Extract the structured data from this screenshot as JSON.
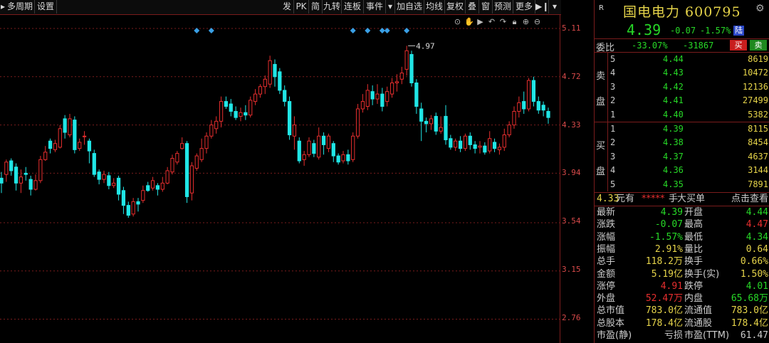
{
  "toolbar": {
    "left": [
      "多周期",
      "设置"
    ],
    "right": [
      "发",
      "PK",
      "简",
      "九转",
      "连板",
      "事件",
      "加自选",
      "均线",
      "复权",
      "叠",
      "窗",
      "预测",
      "更多"
    ]
  },
  "price_axis": [
    "5.11",
    "4.72",
    "4.33",
    "3.94",
    "3.54",
    "3.15",
    "2.76"
  ],
  "colors": {
    "up": "#e62e2e",
    "down": "#20e6e6",
    "green": "#27d827",
    "yellow": "#e6d44a",
    "grid": "#7a1c1c"
  },
  "chart_data": {
    "type": "candlestick",
    "high_label": "4.97",
    "ylim": [
      2.62,
      5.18
    ],
    "candles": [
      {
        "o": 3.9,
        "c": 3.86,
        "h": 3.95,
        "l": 3.78
      },
      {
        "o": 3.93,
        "c": 4.03,
        "h": 4.05,
        "l": 3.87
      },
      {
        "o": 4.04,
        "c": 3.96,
        "h": 4.06,
        "l": 3.92
      },
      {
        "o": 3.99,
        "c": 3.86,
        "h": 4.02,
        "l": 3.8
      },
      {
        "o": 3.86,
        "c": 3.91,
        "h": 3.97,
        "l": 3.78
      },
      {
        "o": 3.94,
        "c": 3.93,
        "h": 3.99,
        "l": 3.88
      },
      {
        "o": 3.89,
        "c": 3.81,
        "h": 3.92,
        "l": 3.76
      },
      {
        "o": 3.81,
        "c": 3.88,
        "h": 3.93,
        "l": 3.8
      },
      {
        "o": 3.88,
        "c": 4.05,
        "h": 4.08,
        "l": 3.86
      },
      {
        "o": 4.05,
        "c": 4.11,
        "h": 4.16,
        "l": 4.04
      },
      {
        "o": 4.2,
        "c": 4.14,
        "h": 4.22,
        "l": 4.1
      },
      {
        "o": 4.13,
        "c": 4.18,
        "h": 4.21,
        "l": 4.11
      },
      {
        "o": 4.15,
        "c": 4.3,
        "h": 4.33,
        "l": 4.14
      },
      {
        "o": 4.38,
        "c": 4.27,
        "h": 4.41,
        "l": 4.22
      },
      {
        "o": 4.25,
        "c": 4.38,
        "h": 4.42,
        "l": 4.23
      },
      {
        "o": 4.37,
        "c": 4.13,
        "h": 4.4,
        "l": 4.1
      },
      {
        "o": 4.14,
        "c": 4.19,
        "h": 4.22,
        "l": 4.12
      },
      {
        "o": 4.24,
        "c": 4.24,
        "h": 4.28,
        "l": 4.17
      },
      {
        "o": 4.2,
        "c": 4.12,
        "h": 4.22,
        "l": 4.02
      },
      {
        "o": 4.1,
        "c": 3.93,
        "h": 4.13,
        "l": 3.91
      },
      {
        "o": 3.95,
        "c": 3.89,
        "h": 3.97,
        "l": 3.85
      },
      {
        "o": 3.89,
        "c": 3.93,
        "h": 3.96,
        "l": 3.86
      },
      {
        "o": 3.92,
        "c": 3.84,
        "h": 3.95,
        "l": 3.81
      },
      {
        "o": 3.84,
        "c": 3.86,
        "h": 3.9,
        "l": 3.82
      },
      {
        "o": 3.9,
        "c": 3.77,
        "h": 3.92,
        "l": 3.72
      },
      {
        "o": 3.8,
        "c": 3.68,
        "h": 3.83,
        "l": 3.61
      },
      {
        "o": 3.68,
        "c": 3.6,
        "h": 3.71,
        "l": 3.58
      },
      {
        "o": 3.61,
        "c": 3.71,
        "h": 3.74,
        "l": 3.59
      },
      {
        "o": 3.71,
        "c": 3.69,
        "h": 3.74,
        "l": 3.63
      },
      {
        "o": 3.72,
        "c": 3.8,
        "h": 3.84,
        "l": 3.7
      },
      {
        "o": 3.84,
        "c": 3.8,
        "h": 3.87,
        "l": 3.79
      },
      {
        "o": 3.82,
        "c": 3.88,
        "h": 3.91,
        "l": 3.8
      },
      {
        "o": 3.84,
        "c": 3.81,
        "h": 3.86,
        "l": 3.76
      },
      {
        "o": 3.81,
        "c": 3.86,
        "h": 3.91,
        "l": 3.79
      },
      {
        "o": 3.86,
        "c": 3.96,
        "h": 3.99,
        "l": 3.85
      },
      {
        "o": 3.95,
        "c": 4.06,
        "h": 4.09,
        "l": 3.93
      },
      {
        "o": 4.03,
        "c": 4.1,
        "h": 4.12,
        "l": 4.01
      },
      {
        "o": 4.14,
        "c": 4.18,
        "h": 4.23,
        "l": 4.13
      },
      {
        "o": 4.18,
        "c": 3.75,
        "h": 4.2,
        "l": 3.7
      },
      {
        "o": 3.78,
        "c": 4.0,
        "h": 4.03,
        "l": 3.72
      },
      {
        "o": 3.98,
        "c": 4.08,
        "h": 4.1,
        "l": 3.96
      },
      {
        "o": 4.05,
        "c": 4.14,
        "h": 4.22,
        "l": 4.03
      },
      {
        "o": 4.14,
        "c": 4.24,
        "h": 4.27,
        "l": 4.1
      },
      {
        "o": 4.24,
        "c": 4.33,
        "h": 4.37,
        "l": 4.22
      },
      {
        "o": 4.3,
        "c": 4.36,
        "h": 4.4,
        "l": 4.26
      },
      {
        "o": 4.36,
        "c": 4.52,
        "h": 4.56,
        "l": 4.31
      },
      {
        "o": 4.52,
        "c": 4.48,
        "h": 4.56,
        "l": 4.46
      },
      {
        "o": 4.5,
        "c": 4.44,
        "h": 4.54,
        "l": 4.4
      },
      {
        "o": 4.44,
        "c": 4.39,
        "h": 4.48,
        "l": 4.37
      },
      {
        "o": 4.4,
        "c": 4.43,
        "h": 4.47,
        "l": 4.36
      },
      {
        "o": 4.43,
        "c": 4.41,
        "h": 4.49,
        "l": 4.37
      },
      {
        "o": 4.41,
        "c": 4.53,
        "h": 4.56,
        "l": 4.39
      },
      {
        "o": 4.52,
        "c": 4.58,
        "h": 4.62,
        "l": 4.49
      },
      {
        "o": 4.58,
        "c": 4.64,
        "h": 4.66,
        "l": 4.55
      },
      {
        "o": 4.64,
        "c": 4.7,
        "h": 4.73,
        "l": 4.58
      },
      {
        "o": 4.66,
        "c": 4.85,
        "h": 4.89,
        "l": 4.63
      },
      {
        "o": 4.82,
        "c": 4.72,
        "h": 4.86,
        "l": 4.64
      },
      {
        "o": 4.76,
        "c": 4.61,
        "h": 4.79,
        "l": 4.58
      },
      {
        "o": 4.61,
        "c": 4.52,
        "h": 4.65,
        "l": 4.48
      },
      {
        "o": 4.52,
        "c": 4.25,
        "h": 4.56,
        "l": 4.21
      },
      {
        "o": 4.24,
        "c": 4.33,
        "h": 4.4,
        "l": 4.13
      },
      {
        "o": 4.2,
        "c": 4.04,
        "h": 4.23,
        "l": 4.02
      },
      {
        "o": 4.05,
        "c": 4.09,
        "h": 4.12,
        "l": 4.0
      },
      {
        "o": 4.09,
        "c": 4.2,
        "h": 4.23,
        "l": 4.07
      },
      {
        "o": 4.18,
        "c": 4.1,
        "h": 4.21,
        "l": 4.07
      },
      {
        "o": 4.07,
        "c": 4.24,
        "h": 4.31,
        "l": 4.05
      },
      {
        "o": 4.24,
        "c": 4.17,
        "h": 4.27,
        "l": 4.09
      },
      {
        "o": 4.14,
        "c": 4.24,
        "h": 4.26,
        "l": 4.11
      },
      {
        "o": 4.18,
        "c": 4.08,
        "h": 4.2,
        "l": 4.03
      },
      {
        "o": 4.08,
        "c": 4.03,
        "h": 4.1,
        "l": 4.01
      },
      {
        "o": 4.04,
        "c": 4.09,
        "h": 4.12,
        "l": 4.02
      },
      {
        "o": 4.09,
        "c": 4.04,
        "h": 4.13,
        "l": 4.01
      },
      {
        "o": 4.05,
        "c": 4.24,
        "h": 4.27,
        "l": 4.03
      },
      {
        "o": 4.24,
        "c": 4.46,
        "h": 4.5,
        "l": 4.22
      },
      {
        "o": 4.46,
        "c": 4.52,
        "h": 4.58,
        "l": 4.43
      },
      {
        "o": 4.48,
        "c": 4.61,
        "h": 4.66,
        "l": 4.45
      },
      {
        "o": 4.6,
        "c": 4.54,
        "h": 4.65,
        "l": 4.49
      },
      {
        "o": 4.54,
        "c": 4.58,
        "h": 4.66,
        "l": 4.5
      },
      {
        "o": 4.58,
        "c": 4.48,
        "h": 4.63,
        "l": 4.44
      },
      {
        "o": 4.52,
        "c": 4.6,
        "h": 4.64,
        "l": 4.48
      },
      {
        "o": 4.58,
        "c": 4.67,
        "h": 4.71,
        "l": 4.55
      },
      {
        "o": 4.67,
        "c": 4.68,
        "h": 4.74,
        "l": 4.6
      },
      {
        "o": 4.7,
        "c": 4.75,
        "h": 4.8,
        "l": 4.66
      },
      {
        "o": 4.78,
        "c": 4.93,
        "h": 4.97,
        "l": 4.73
      },
      {
        "o": 4.9,
        "c": 4.67,
        "h": 4.93,
        "l": 4.64
      },
      {
        "o": 4.67,
        "c": 4.48,
        "h": 4.7,
        "l": 4.42
      },
      {
        "o": 4.46,
        "c": 4.36,
        "h": 4.51,
        "l": 4.2
      },
      {
        "o": 4.36,
        "c": 4.34,
        "h": 4.39,
        "l": 4.27
      },
      {
        "o": 4.34,
        "c": 4.38,
        "h": 4.41,
        "l": 4.29
      },
      {
        "o": 4.4,
        "c": 4.28,
        "h": 4.43,
        "l": 4.25
      },
      {
        "o": 4.28,
        "c": 4.31,
        "h": 4.4,
        "l": 4.26
      },
      {
        "o": 4.4,
        "c": 4.21,
        "h": 4.49,
        "l": 4.17
      },
      {
        "o": 4.22,
        "c": 4.15,
        "h": 4.25,
        "l": 4.13
      },
      {
        "o": 4.15,
        "c": 4.2,
        "h": 4.22,
        "l": 4.12
      },
      {
        "o": 4.2,
        "c": 4.14,
        "h": 4.24,
        "l": 4.11
      },
      {
        "o": 4.14,
        "c": 4.24,
        "h": 4.26,
        "l": 4.12
      },
      {
        "o": 4.24,
        "c": 4.17,
        "h": 4.27,
        "l": 4.13
      },
      {
        "o": 4.17,
        "c": 4.14,
        "h": 4.2,
        "l": 4.1
      },
      {
        "o": 4.15,
        "c": 4.16,
        "h": 4.2,
        "l": 4.1
      },
      {
        "o": 4.16,
        "c": 4.11,
        "h": 4.19,
        "l": 4.09
      },
      {
        "o": 4.12,
        "c": 4.22,
        "h": 4.28,
        "l": 4.1
      },
      {
        "o": 4.19,
        "c": 4.14,
        "h": 4.22,
        "l": 4.11
      },
      {
        "o": 4.13,
        "c": 4.15,
        "h": 4.18,
        "l": 4.09
      },
      {
        "o": 4.15,
        "c": 4.25,
        "h": 4.3,
        "l": 4.12
      },
      {
        "o": 4.25,
        "c": 4.33,
        "h": 4.36,
        "l": 4.23
      },
      {
        "o": 4.33,
        "c": 4.44,
        "h": 4.48,
        "l": 4.3
      },
      {
        "o": 4.44,
        "c": 4.51,
        "h": 4.56,
        "l": 4.39
      },
      {
        "o": 4.52,
        "c": 4.46,
        "h": 4.6,
        "l": 4.42
      },
      {
        "o": 4.46,
        "c": 4.69,
        "h": 4.71,
        "l": 4.44
      },
      {
        "o": 4.69,
        "c": 4.52,
        "h": 4.72,
        "l": 4.48
      },
      {
        "o": 4.52,
        "c": 4.45,
        "h": 4.56,
        "l": 4.42
      },
      {
        "o": 4.49,
        "c": 4.45,
        "h": 4.52,
        "l": 4.4
      },
      {
        "o": 4.44,
        "c": 4.39,
        "h": 4.47,
        "l": 4.34
      }
    ],
    "event_marker_indices": [
      40,
      43,
      72,
      75,
      78,
      79,
      83
    ]
  },
  "quote": {
    "badge": "R",
    "title": "国电电力 600795",
    "price": "4.39",
    "change": "-0.07",
    "pct": "-1.57%",
    "board": "陆"
  },
  "webi": {
    "label": "委比",
    "ratio": "-33.07%",
    "diff": "-31867",
    "buy": "买",
    "sell": "卖"
  },
  "asks": {
    "side": [
      "卖",
      "盘"
    ],
    "rows": [
      {
        "lv": "5",
        "pr": "4.44",
        "qt": "8619"
      },
      {
        "lv": "4",
        "pr": "4.43",
        "qt": "10472"
      },
      {
        "lv": "3",
        "pr": "4.42",
        "qt": "12136"
      },
      {
        "lv": "2",
        "pr": "4.41",
        "qt": "27499"
      },
      {
        "lv": "1",
        "pr": "4.40",
        "qt": "5382"
      }
    ]
  },
  "bids": {
    "side": [
      "买",
      "盘"
    ],
    "rows": [
      {
        "lv": "1",
        "pr": "4.39",
        "qt": "8115"
      },
      {
        "lv": "2",
        "pr": "4.38",
        "qt": "8454"
      },
      {
        "lv": "3",
        "pr": "4.37",
        "qt": "4637"
      },
      {
        "lv": "4",
        "pr": "4.36",
        "qt": "3144"
      },
      {
        "lv": "5",
        "pr": "4.35",
        "qt": "7891"
      }
    ]
  },
  "bigorder": {
    "price": "4.33",
    "unit": "元有",
    "stars": "*****",
    "hand": "手",
    "big": "大买单",
    "check": "点击查看"
  },
  "stats": [
    {
      "k1": "最新",
      "v1": "4.39",
      "c1": "#27d827",
      "k2": "开盘",
      "v2": "4.44",
      "c2": "#27d827"
    },
    {
      "k1": "涨跌",
      "v1": "-0.07",
      "c1": "#27d827",
      "k2": "最高",
      "v2": "4.47",
      "c2": "#e62e2e"
    },
    {
      "k1": "涨幅",
      "v1": "-1.57%",
      "c1": "#27d827",
      "k2": "最低",
      "v2": "4.34",
      "c2": "#27d827"
    },
    {
      "k1": "振幅",
      "v1": "2.91%",
      "c1": "#e6d44a",
      "k2": "量比",
      "v2": "0.64",
      "c2": "#e6d44a"
    },
    {
      "k1": "总手",
      "v1": "118.2万",
      "c1": "#e6d44a",
      "k2": "换手",
      "v2": "0.66%",
      "c2": "#e6d44a"
    },
    {
      "k1": "金额",
      "v1": "5.19亿",
      "c1": "#e6d44a",
      "k2": "换手(实)",
      "v2": "1.50%",
      "c2": "#e6d44a"
    },
    {
      "k1": "涨停",
      "v1": "4.91",
      "c1": "#e62e2e",
      "k2": "跌停",
      "v2": "4.01",
      "c2": "#27d827"
    },
    {
      "k1": "外盘",
      "v1": "52.47万",
      "c1": "#e62e2e",
      "k2": "内盘",
      "v2": "65.68万",
      "c2": "#27d827"
    },
    {
      "k1": "总市值",
      "v1": "783.0亿",
      "c1": "#e6d44a",
      "k2": "流通值",
      "v2": "783.0亿",
      "c2": "#e6d44a"
    },
    {
      "k1": "总股本",
      "v1": "178.4亿",
      "c1": "#e6d44a",
      "k2": "流通股",
      "v2": "178.4亿",
      "c2": "#e6d44a"
    },
    {
      "k1": "市盈(静)",
      "v1": "亏损",
      "c1": "#ccc",
      "k2": "市盈(TTM)",
      "v2": "61.47",
      "c2": "#ccc"
    }
  ]
}
